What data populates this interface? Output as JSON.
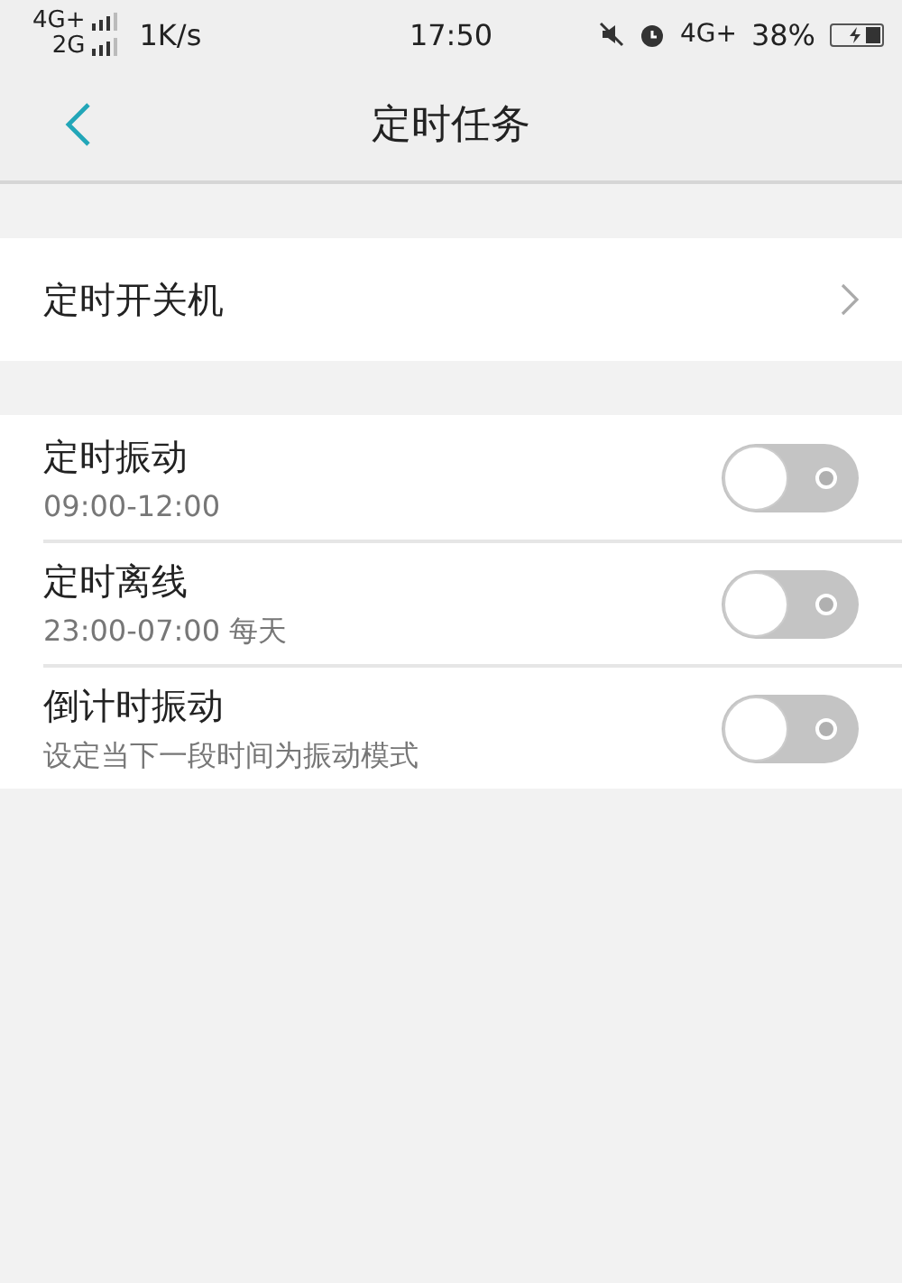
{
  "status_bar": {
    "network_top": "4G+",
    "network_bottom": "2G",
    "speed": "1K/s",
    "time": "17:50",
    "network_right": "4G+",
    "battery": "38%",
    "charging": true
  },
  "header": {
    "title": "定时任务"
  },
  "nav_items": [
    {
      "label": "定时开关机"
    }
  ],
  "toggles": [
    {
      "label": "定时振动",
      "detail": "09:00-12:00",
      "on": false
    },
    {
      "label": "定时离线",
      "detail": "23:00-07:00 每天",
      "on": false
    },
    {
      "label": "倒计时振动",
      "detail": "设定当下一段时间为振动模式",
      "on": false
    }
  ]
}
